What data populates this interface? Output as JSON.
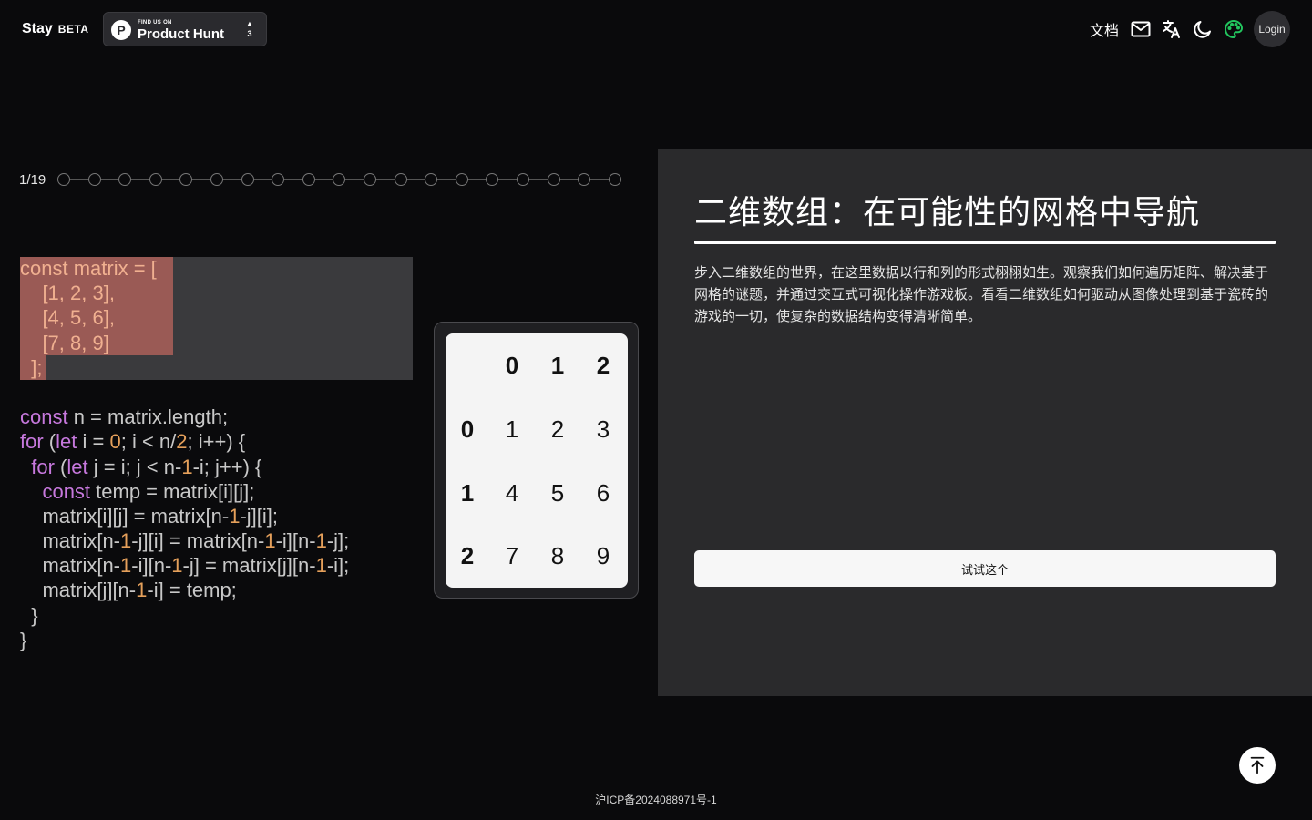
{
  "header": {
    "brand": "Stay",
    "brand_badge": "BETA",
    "product_hunt": {
      "find_us": "FIND US ON",
      "name": "Product Hunt",
      "logo_letter": "P",
      "vote_arrow": "▲",
      "votes": "3"
    },
    "docs_label": "文档",
    "icons": [
      "mail-icon",
      "translate-icon",
      "moon-icon",
      "palette-icon"
    ],
    "login_label": "Login"
  },
  "progress": {
    "label": "1/19",
    "total_steps": 19,
    "current_step": 1
  },
  "code": {
    "lines": [
      [
        {
          "t": "const matrix = [",
          "c": "hl"
        }
      ],
      [
        {
          "t": "    [1, 2, 3],",
          "c": "hl"
        }
      ],
      [
        {
          "t": "    [4, 5, 6],",
          "c": "hl"
        }
      ],
      [
        {
          "t": "    [7, 8, 9]",
          "c": "hl"
        }
      ],
      [
        {
          "t": "  ];",
          "c": "hl"
        }
      ],
      [
        {
          "t": "",
          "c": ""
        }
      ],
      [
        {
          "t": "const",
          "c": "kw"
        },
        {
          "t": " n = matrix.length;",
          "c": ""
        }
      ],
      [
        {
          "t": "for",
          "c": "kw"
        },
        {
          "t": " (",
          "c": ""
        },
        {
          "t": "let",
          "c": "kw"
        },
        {
          "t": " i = ",
          "c": ""
        },
        {
          "t": "0",
          "c": "num"
        },
        {
          "t": "; i < n/",
          "c": ""
        },
        {
          "t": "2",
          "c": "num"
        },
        {
          "t": "; i++) {",
          "c": ""
        }
      ],
      [
        {
          "t": "  ",
          "c": ""
        },
        {
          "t": "for",
          "c": "kw"
        },
        {
          "t": " (",
          "c": ""
        },
        {
          "t": "let",
          "c": "kw"
        },
        {
          "t": " j = i; j < n-",
          "c": ""
        },
        {
          "t": "1",
          "c": "num"
        },
        {
          "t": "-i; j++) {",
          "c": ""
        }
      ],
      [
        {
          "t": "    ",
          "c": ""
        },
        {
          "t": "const",
          "c": "kw"
        },
        {
          "t": " temp = matrix[i][j];",
          "c": ""
        }
      ],
      [
        {
          "t": "    matrix[i][j] = matrix[n-",
          "c": ""
        },
        {
          "t": "1",
          "c": "num"
        },
        {
          "t": "-j][i];",
          "c": ""
        }
      ],
      [
        {
          "t": "    matrix[n-",
          "c": ""
        },
        {
          "t": "1",
          "c": "num"
        },
        {
          "t": "-j][i] = matrix[n-",
          "c": ""
        },
        {
          "t": "1",
          "c": "num"
        },
        {
          "t": "-i][n-",
          "c": ""
        },
        {
          "t": "1",
          "c": "num"
        },
        {
          "t": "-j];",
          "c": ""
        }
      ],
      [
        {
          "t": "    matrix[n-",
          "c": ""
        },
        {
          "t": "1",
          "c": "num"
        },
        {
          "t": "-i][n-",
          "c": ""
        },
        {
          "t": "1",
          "c": "num"
        },
        {
          "t": "-j] = matrix[j][n-",
          "c": ""
        },
        {
          "t": "1",
          "c": "num"
        },
        {
          "t": "-i];",
          "c": ""
        }
      ],
      [
        {
          "t": "    matrix[j][n-",
          "c": ""
        },
        {
          "t": "1",
          "c": "num"
        },
        {
          "t": "-i] = temp;",
          "c": ""
        }
      ],
      [
        {
          "t": "  }",
          "c": ""
        }
      ],
      [
        {
          "t": "}",
          "c": ""
        }
      ]
    ]
  },
  "matrix": {
    "col_headers": [
      "0",
      "1",
      "2"
    ],
    "row_headers": [
      "0",
      "1",
      "2"
    ],
    "cells": [
      [
        "1",
        "2",
        "3"
      ],
      [
        "4",
        "5",
        "6"
      ],
      [
        "7",
        "8",
        "9"
      ]
    ]
  },
  "info": {
    "title": "二维数组：在可能性的网格中导航",
    "description": "步入二维数组的世界，在这里数据以行和列的形式栩栩如生。观察我们如何遍历矩阵、解决基于网格的谜题，并通过交互式可视化操作游戏板。看看二维数组如何驱动从图像处理到基于瓷砖的游戏的一切，使复杂的数据结构变得清晰简单。",
    "try_button": "试试这个"
  },
  "footer": {
    "icp": "沪ICP备2024088971号-1"
  },
  "colors": {
    "background": "#0a0a0c",
    "panel": "#2a2a2c",
    "keyword": "#c678dd",
    "number": "#e5a05b",
    "highlight": "#9a5a55"
  }
}
